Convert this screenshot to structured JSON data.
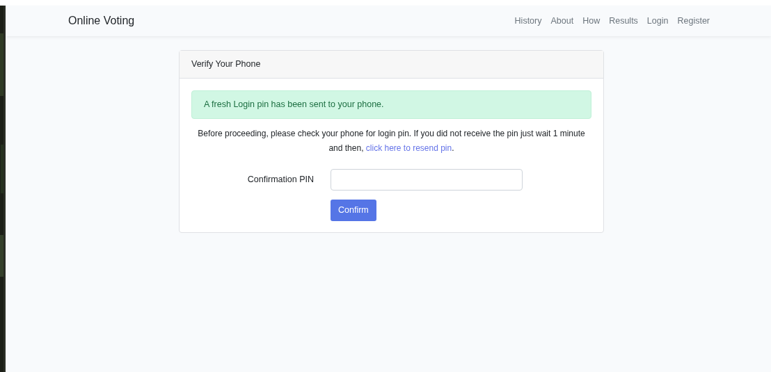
{
  "navbar": {
    "brand": "Online Voting",
    "links": [
      "History",
      "About",
      "How",
      "Results",
      "Login",
      "Register"
    ]
  },
  "card": {
    "title": "Verify Your Phone",
    "alert": "A fresh Login pin has been sent to your phone.",
    "message": "Before proceeding, please check your phone for login pin. If you did not receive the pin just wait 1 minute and then,",
    "link": "click here to resend pin",
    "after_link": ".",
    "field": {
      "label": "Confirmation PIN"
    },
    "button": "Confirm"
  }
}
